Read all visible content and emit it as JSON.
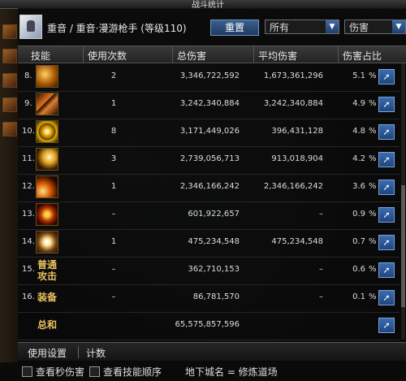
{
  "window": {
    "title": "战斗统计"
  },
  "header": {
    "breadcrumb": "重音 / 重音·漫游枪手 (等级110)",
    "reset_label": "重置",
    "filter_select": "所有",
    "type_select": "伤害"
  },
  "table": {
    "columns": [
      "技能",
      "使用次数",
      "总伤害",
      "平均伤害",
      "伤害占比"
    ],
    "rows": [
      {
        "index": "8.",
        "icon": "skill-icon",
        "count": "2",
        "total": "3,346,722,592",
        "avg": "1,673,361,296",
        "pct": "5.1",
        "pct_sym": "%"
      },
      {
        "index": "9.",
        "icon": "skill-icon",
        "count": "1",
        "total": "3,242,340,884",
        "avg": "3,242,340,884",
        "pct": "4.9",
        "pct_sym": "%"
      },
      {
        "index": "10.",
        "icon": "skill-icon",
        "count": "8",
        "total": "3,171,449,026",
        "avg": "396,431,128",
        "pct": "4.8",
        "pct_sym": "%"
      },
      {
        "index": "11.",
        "icon": "skill-icon",
        "count": "3",
        "total": "2,739,056,713",
        "avg": "913,018,904",
        "pct": "4.2",
        "pct_sym": "%"
      },
      {
        "index": "12.",
        "icon": "skill-icon",
        "count": "1",
        "total": "2,346,166,242",
        "avg": "2,346,166,242",
        "pct": "3.6",
        "pct_sym": "%"
      },
      {
        "index": "13.",
        "icon": "skill-icon",
        "count": "–",
        "total": "601,922,657",
        "avg": "–",
        "pct": "0.9",
        "pct_sym": "%"
      },
      {
        "index": "14.",
        "icon": "skill-icon",
        "count": "1",
        "total": "475,234,548",
        "avg": "475,234,548",
        "pct": "0.7",
        "pct_sym": "%"
      },
      {
        "index": "15.",
        "icon_text": "普通攻击",
        "count": "–",
        "total": "362,710,153",
        "avg": "–",
        "pct": "0.6",
        "pct_sym": "%"
      },
      {
        "index": "16.",
        "icon_text": "装备",
        "count": "–",
        "total": "86,781,570",
        "avg": "–",
        "pct": "0.1",
        "pct_sym": "%"
      },
      {
        "index": "",
        "icon_text": "总和",
        "count": "",
        "total": "65,575,857,596",
        "avg": "",
        "pct": "",
        "pct_sym": ""
      }
    ]
  },
  "tabs": [
    "使用设置",
    "计数"
  ],
  "footer": {
    "checkbox1": "查看秒伤害",
    "checkbox2": "查看技能顺序",
    "map": "地下城名 = 修炼道场"
  },
  "colors": {
    "accent": "#2f5f9f",
    "share_button": "#3b6cb0"
  }
}
